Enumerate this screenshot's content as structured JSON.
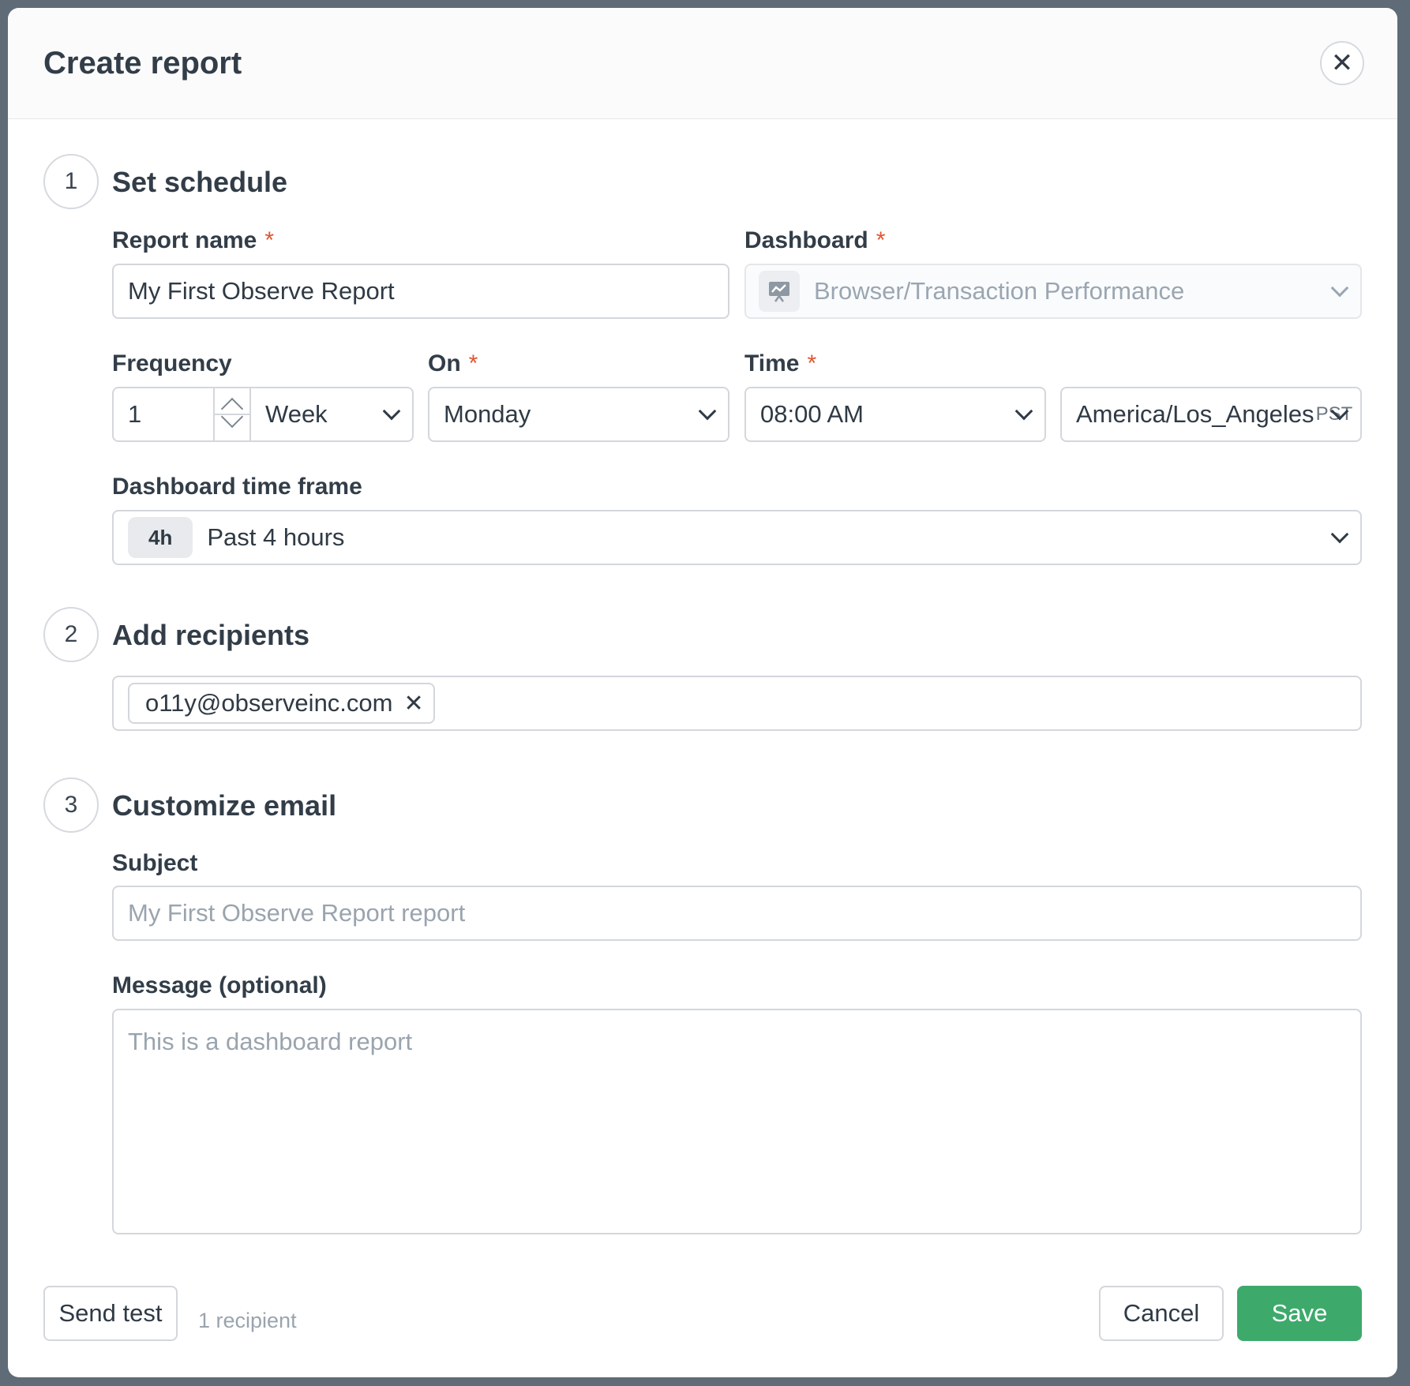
{
  "modal": {
    "title": "Create report"
  },
  "steps": [
    {
      "number": "1",
      "title": "Set schedule"
    },
    {
      "number": "2",
      "title": "Add recipients"
    },
    {
      "number": "3",
      "title": "Customize email"
    }
  ],
  "schedule": {
    "report_name_label": "Report name",
    "report_name_value": "My First Observe Report",
    "dashboard_label": "Dashboard",
    "dashboard_value": "Browser/Transaction Performance",
    "frequency_label": "Frequency",
    "frequency_count": "1",
    "frequency_unit": "Week",
    "on_label": "On",
    "on_value": "Monday",
    "time_label": "Time",
    "time_value": "08:00 AM",
    "timezone_value": "America/Los_Angeles",
    "timezone_suffix": "PST",
    "timeframe_label": "Dashboard time frame",
    "timeframe_badge": "4h",
    "timeframe_value": "Past 4 hours",
    "required_mark": "*"
  },
  "recipients": {
    "tags": [
      "o11y@observeinc.com"
    ],
    "remove_glyph": "✕"
  },
  "email": {
    "subject_label": "Subject",
    "subject_placeholder": "My First Observe Report report",
    "message_label": "Message (optional)",
    "message_placeholder": "This is a dashboard report"
  },
  "footer": {
    "send_test_label": "Send test",
    "recipient_count": "1 recipient",
    "cancel_label": "Cancel",
    "save_label": "Save"
  },
  "colors": {
    "accent_save": "#3daa6c",
    "required": "#e0552f"
  },
  "icons": {
    "close": "close-icon",
    "dashboard": "presentation-chart-icon"
  }
}
